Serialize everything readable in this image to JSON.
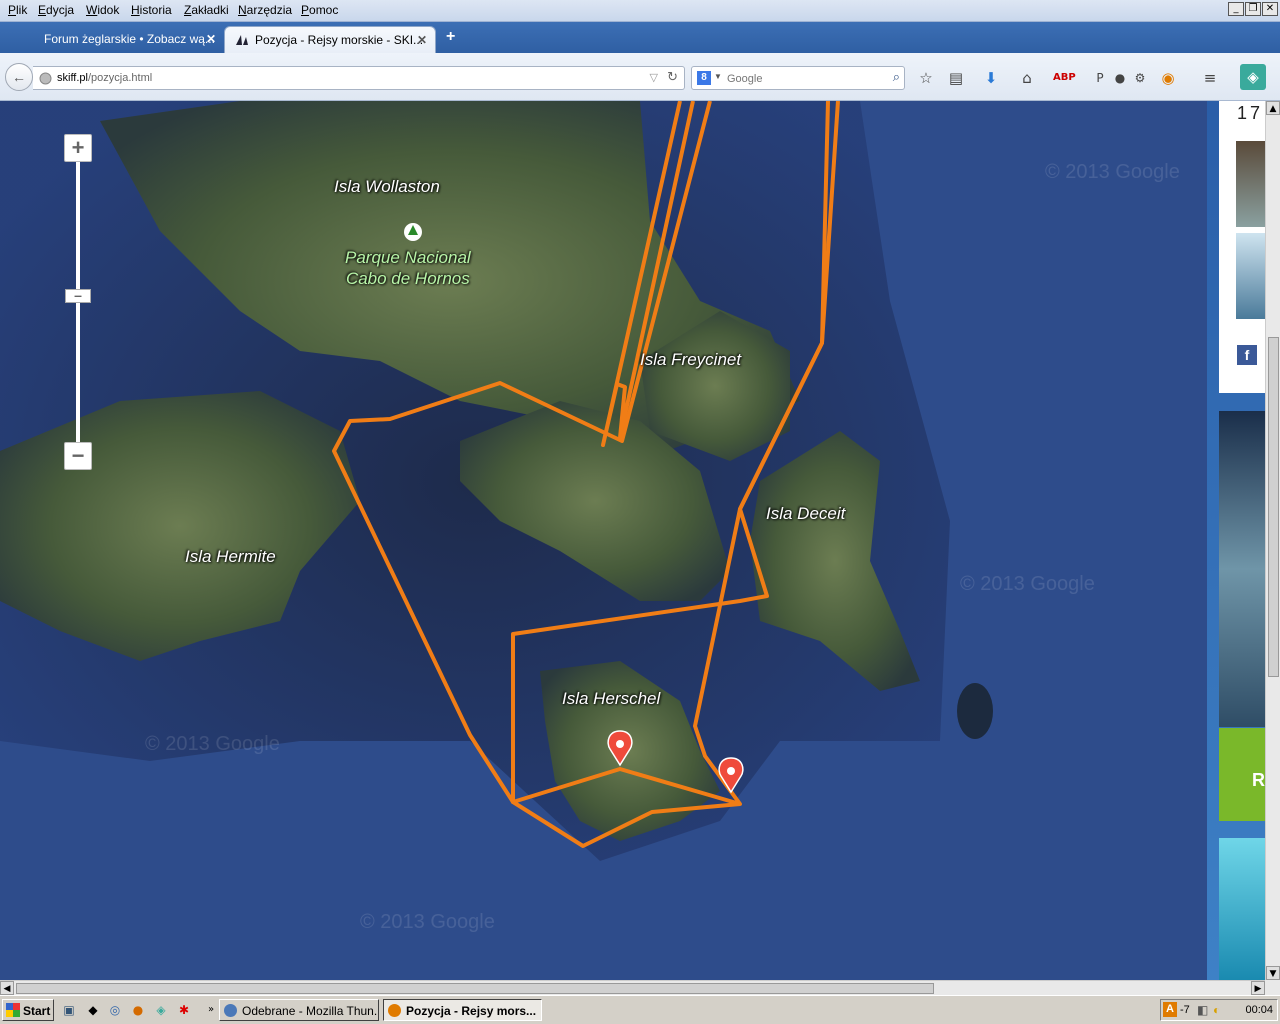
{
  "menubar": {
    "items": [
      "Plik",
      "Edycja",
      "Widok",
      "Historia",
      "Zakładki",
      "Narzędzia",
      "Pomoc"
    ]
  },
  "tabs": [
    {
      "title": "Forum żeglarskie • Zobacz wą...",
      "active": false
    },
    {
      "title": "Pozycja - Rejsy morskie - SKI...",
      "active": true
    }
  ],
  "navbar": {
    "url_domain": "skiff.pl",
    "url_path": "/pozycja.html",
    "search_placeholder": "Google"
  },
  "map": {
    "labels": [
      "Isla Wollaston",
      "Isla Freycinet",
      "Isla Deceit",
      "Isla Hermite",
      "Isla Herschel"
    ],
    "park_label_line1": "Parque Nacional",
    "park_label_line2": "Cabo de Hornos",
    "watermark": "© 2013 Google",
    "route_color": "#f07d16"
  },
  "sidebar": {
    "number_text": "17",
    "green_letter": "R"
  },
  "taskbar": {
    "start_label": "Start",
    "tasks": [
      "Odebrane - Mozilla Thun...",
      "Pozycja - Rejsy mors..."
    ],
    "tray_temp": "-7",
    "clock": "00:04"
  }
}
